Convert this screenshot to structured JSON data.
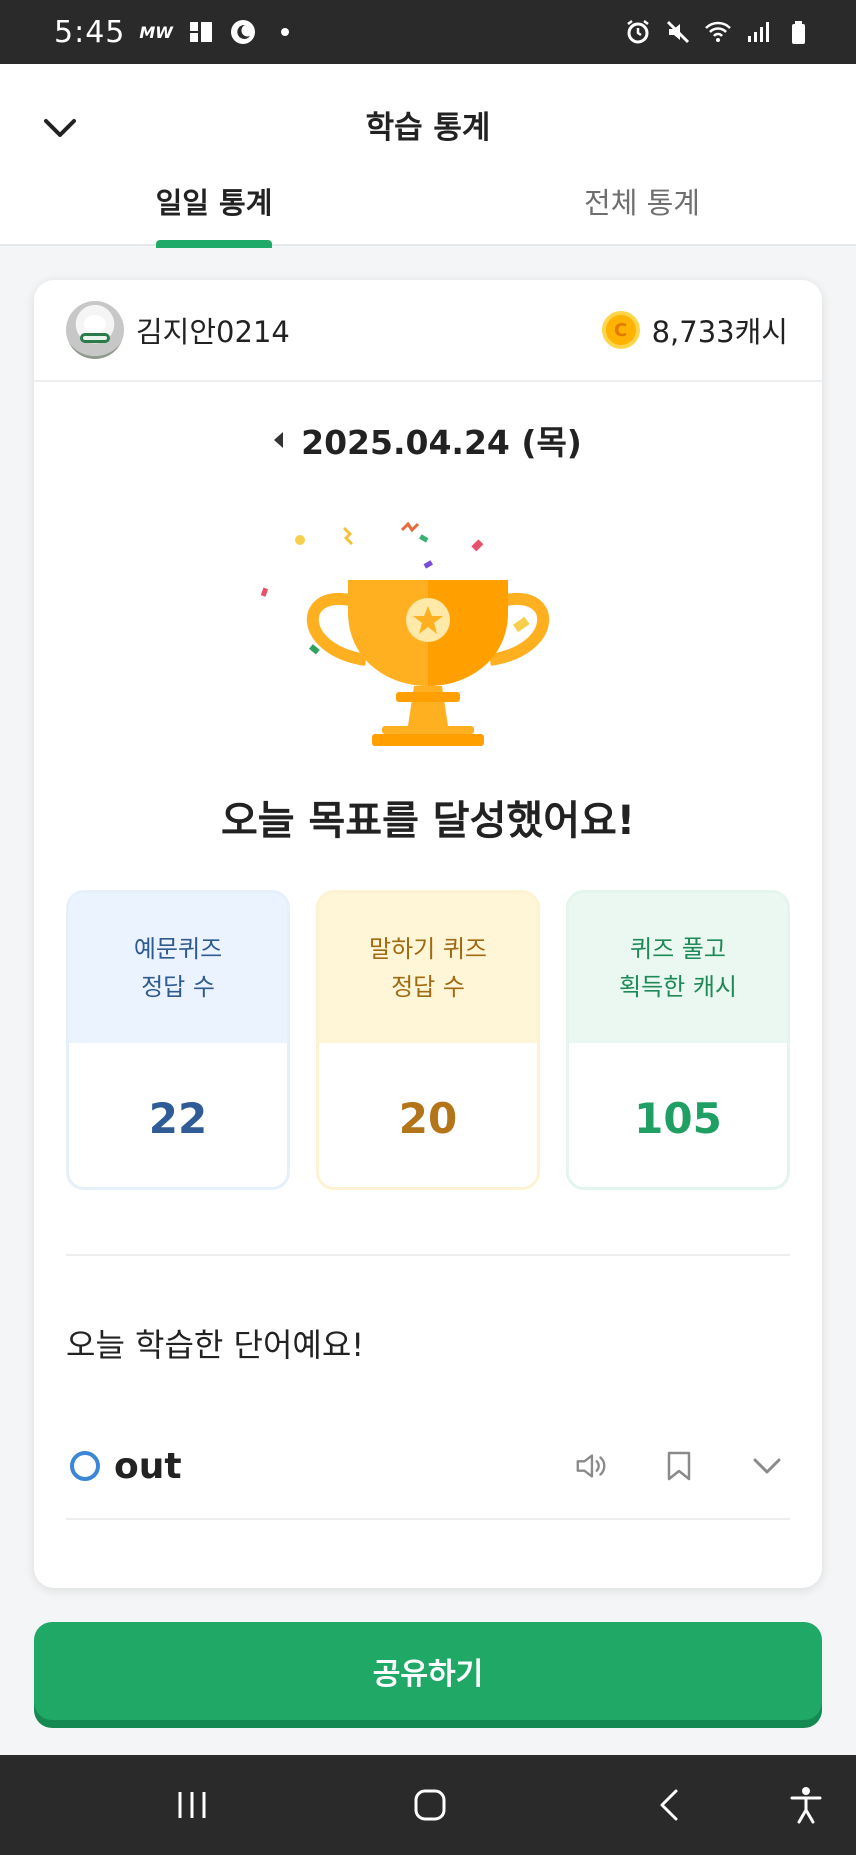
{
  "status_bar": {
    "time": "5:45",
    "carrier_badge": "MW"
  },
  "header": {
    "title": "학습 통계",
    "tabs": [
      {
        "label": "일일 통계",
        "active": true
      },
      {
        "label": "전체 통계",
        "active": false
      }
    ]
  },
  "profile": {
    "username": "김지안0214",
    "cash": "8,733캐시",
    "coin_symbol": "C"
  },
  "date": {
    "value": "2025.04.24 (목)"
  },
  "goal_message": "오늘 목표를 달성했어요!",
  "stats": [
    {
      "label_line1": "예문퀴즈",
      "label_line2": "정답 수",
      "value": "22",
      "color": "#2f5b96"
    },
    {
      "label_line1": "말하기 퀴즈",
      "label_line2": "정답 수",
      "value": "20",
      "color": "#b3741a"
    },
    {
      "label_line1": "퀴즈 풀고",
      "label_line2": "획득한 캐시",
      "value": "105",
      "color": "#1f9f64"
    }
  ],
  "words_section": {
    "title": "오늘 학습한 단어예요!",
    "words": [
      {
        "word": "out"
      }
    ]
  },
  "share_button": {
    "label": "공유하기"
  },
  "colors": {
    "accent": "#1fa866",
    "tab_indicator": "#1faa6a",
    "trophy": "#ffb020"
  }
}
